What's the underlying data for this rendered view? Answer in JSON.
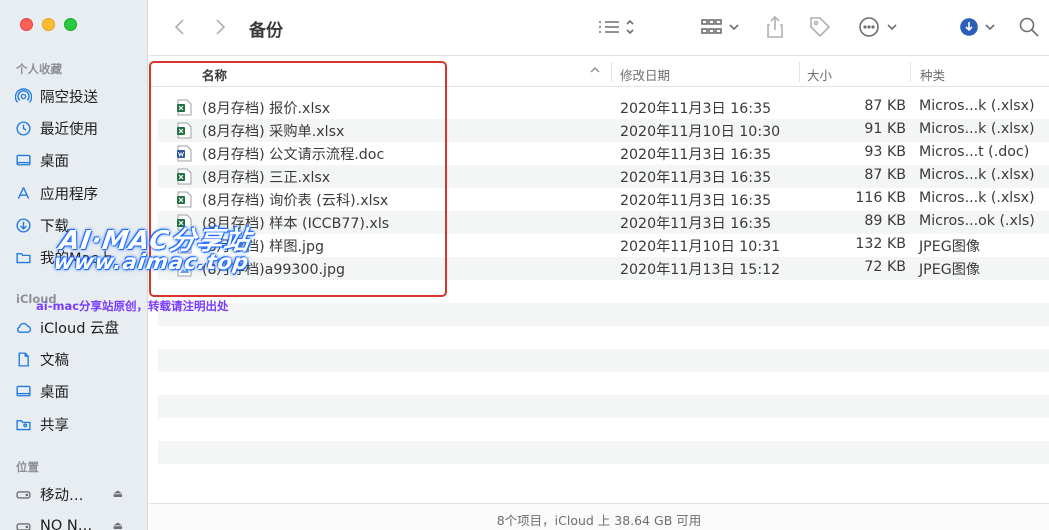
{
  "window": {
    "title": "备份"
  },
  "sidebar": {
    "favorites_header": "个人收藏",
    "favorites": [
      {
        "label": "隔空投送",
        "icon": "airdrop-icon"
      },
      {
        "label": "最近使用",
        "icon": "clock-icon"
      },
      {
        "label": "桌面",
        "icon": "desktop-icon"
      },
      {
        "label": "应用程序",
        "icon": "applications-icon"
      },
      {
        "label": "下载",
        "icon": "download-icon"
      },
      {
        "label": "我的Mac上",
        "icon": "folder-icon"
      }
    ],
    "icloud_header": "iCloud",
    "icloud": [
      {
        "label": "iCloud 云盘",
        "icon": "cloud-icon"
      },
      {
        "label": "文稿",
        "icon": "document-icon"
      },
      {
        "label": "桌面",
        "icon": "desktop-icon"
      },
      {
        "label": "共享",
        "icon": "shared-folder-icon"
      }
    ],
    "locations_header": "位置",
    "locations": [
      {
        "label": "移动…",
        "icon": "drive-icon"
      },
      {
        "label": "NO N…",
        "icon": "drive-icon"
      }
    ]
  },
  "columns": {
    "name": "名称",
    "modified": "修改日期",
    "size": "大小",
    "kind": "种类"
  },
  "files": [
    {
      "name": "(8月存档) 报价.xlsx",
      "date": "2020年11月3日 16:35",
      "size": "87 KB",
      "kind": "Micros...k (.xlsx)",
      "type": "excel"
    },
    {
      "name": "(8月存档) 采购单.xlsx",
      "date": "2020年11月10日 10:30",
      "size": "91 KB",
      "kind": "Micros...k (.xlsx)",
      "type": "excel"
    },
    {
      "name": "(8月存档) 公文请示流程.doc",
      "date": "2020年11月3日 16:35",
      "size": "93 KB",
      "kind": "Micros...t (.doc)",
      "type": "word"
    },
    {
      "name": "(8月存档) 三正.xlsx",
      "date": "2020年11月3日 16:35",
      "size": "87 KB",
      "kind": "Micros...k (.xlsx)",
      "type": "excel"
    },
    {
      "name": "(8月存档) 询价表 (云科).xlsx",
      "date": "2020年11月3日 16:35",
      "size": "116 KB",
      "kind": "Micros...k (.xlsx)",
      "type": "excel"
    },
    {
      "name": "(8月存档) 样本 (ICCB77).xls",
      "date": "2020年11月3日 16:35",
      "size": "89 KB",
      "kind": "Micros...ok (.xls)",
      "type": "excel"
    },
    {
      "name": "(8月存档) 样图.jpg",
      "date": "2020年11月10日 10:31",
      "size": "132 KB",
      "kind": "JPEG图像",
      "type": "image"
    },
    {
      "name": "(8月存档)a99300.jpg",
      "date": "2020年11月13日 15:12",
      "size": "72 KB",
      "kind": "JPEG图像",
      "type": "image"
    }
  ],
  "status": "8个项目，iCloud 上 38.64 GB 可用",
  "watermark": {
    "line1": "AI·MAC分享站",
    "line2": "www.aimac.top",
    "line3": "ai-mac分享站原创，转载请注明出处"
  },
  "colors": {
    "accent": "#1f7ae0",
    "highlight": "#d9342b",
    "excel": "#1d6f42",
    "word": "#2b579a"
  }
}
